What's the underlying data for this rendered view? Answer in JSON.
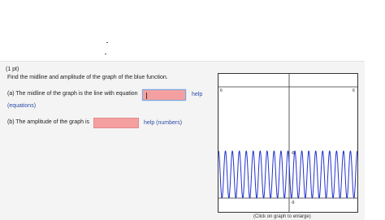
{
  "problem": {
    "points": "(1 pt)",
    "prompt": "Find the midline and amplitude of the graph of the blue function.",
    "part_a": {
      "text": "(a) The midline of the graph is the line with equation",
      "input_value": "",
      "help_label": "help",
      "help_sub_label": "(equations)"
    },
    "part_b": {
      "text": "(b) The amplitude of the graph is",
      "input_value": "",
      "help_label": "help (numbers)"
    }
  },
  "graph": {
    "caption": "(Click on graph to enlarge)",
    "y_top_label": "6",
    "y_top_right_label": "6",
    "y_mid_label": "-6",
    "y_bottom_label": "-9",
    "curve_color": "#2233cc",
    "chart_data": {
      "type": "line",
      "title": "",
      "xlabel": "",
      "ylabel": "",
      "ylim": [
        -9,
        6
      ],
      "series": [
        {
          "function": "sinusoid",
          "max": -6,
          "min": -9,
          "cycles_visible": 20
        }
      ]
    }
  }
}
